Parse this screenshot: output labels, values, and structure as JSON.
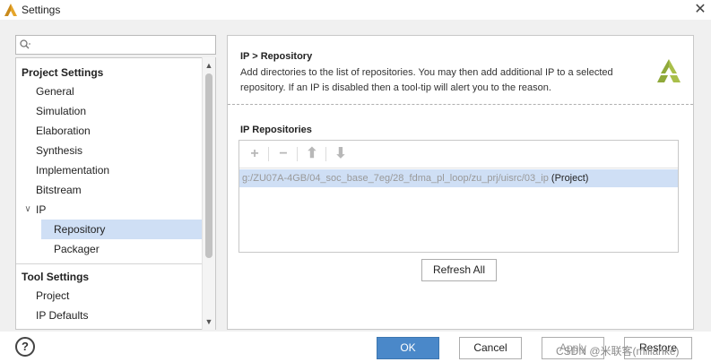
{
  "window": {
    "title": "Settings"
  },
  "search": {
    "placeholder": ""
  },
  "tree": {
    "project_settings": "Project Settings",
    "items": [
      "General",
      "Simulation",
      "Elaboration",
      "Synthesis",
      "Implementation",
      "Bitstream"
    ],
    "ip_group": "IP",
    "ip_children": [
      "Repository",
      "Packager"
    ],
    "tool_settings": "Tool Settings",
    "tool_items": [
      "Project",
      "IP Defaults"
    ]
  },
  "panel": {
    "title": "IP > Repository",
    "description": "Add directories to the list of repositories. You may then add additional IP to a selected repository. If an IP is disabled then a tool-tip will alert you to the reason.",
    "repositories_label": "IP Repositories",
    "repo_path": "g:/ZU07A-4GB/04_soc_base_7eg/28_fdma_pl_loop/zu_prj/uisrc/03_ip",
    "repo_suffix": " (Project)",
    "refresh_label": "Refresh All"
  },
  "toolbar": {
    "add_icon": "add-icon",
    "remove_icon": "remove-icon",
    "up_icon": "move-up-icon",
    "down_icon": "move-down-icon"
  },
  "buttons": {
    "ok": "OK",
    "cancel": "Cancel",
    "apply": "Apply",
    "restore": "Restore"
  },
  "help": {
    "label": "?"
  },
  "watermark": "CSDN @米联客(milianke)",
  "colors": {
    "primary": "#4a88c9",
    "selection": "#cfdff5",
    "brand": "#8fa93a"
  }
}
